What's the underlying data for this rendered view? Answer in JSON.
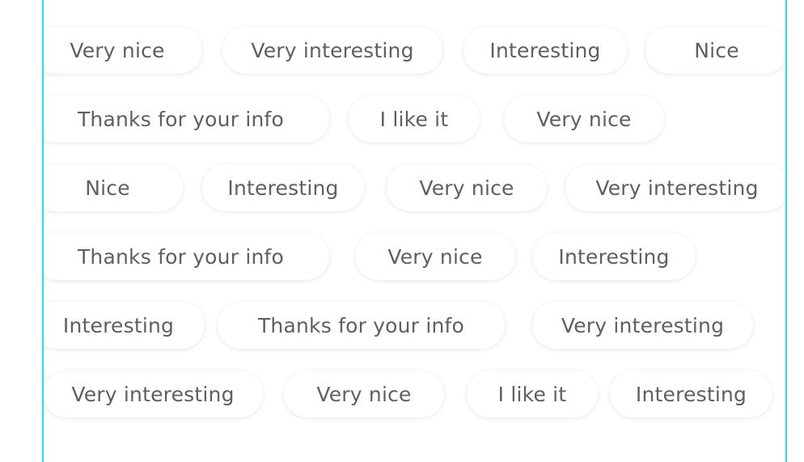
{
  "theme": {
    "border_color": "#1ee5ee",
    "chip_text_color": "#5f5f5f",
    "chip_bg": "#ffffff"
  },
  "rows": [
    {
      "chips": [
        {
          "label": "Very nice"
        },
        {
          "label": "Very interesting"
        },
        {
          "label": "Interesting"
        },
        {
          "label": "Nice"
        }
      ]
    },
    {
      "chips": [
        {
          "label": "Thanks for your info"
        },
        {
          "label": "I like it"
        },
        {
          "label": "Very nice"
        }
      ]
    },
    {
      "chips": [
        {
          "label": "Nice"
        },
        {
          "label": "Interesting"
        },
        {
          "label": "Very nice"
        },
        {
          "label": "Very interesting"
        }
      ]
    },
    {
      "chips": [
        {
          "label": "Thanks for your info"
        },
        {
          "label": "Very nice"
        },
        {
          "label": "Interesting"
        }
      ]
    },
    {
      "chips": [
        {
          "label": "Interesting"
        },
        {
          "label": "Thanks for your info"
        },
        {
          "label": "Very interesting"
        }
      ]
    },
    {
      "chips": [
        {
          "label": "Very interesting"
        },
        {
          "label": "Very nice"
        },
        {
          "label": "I like it"
        },
        {
          "label": "Interesting"
        }
      ]
    }
  ]
}
